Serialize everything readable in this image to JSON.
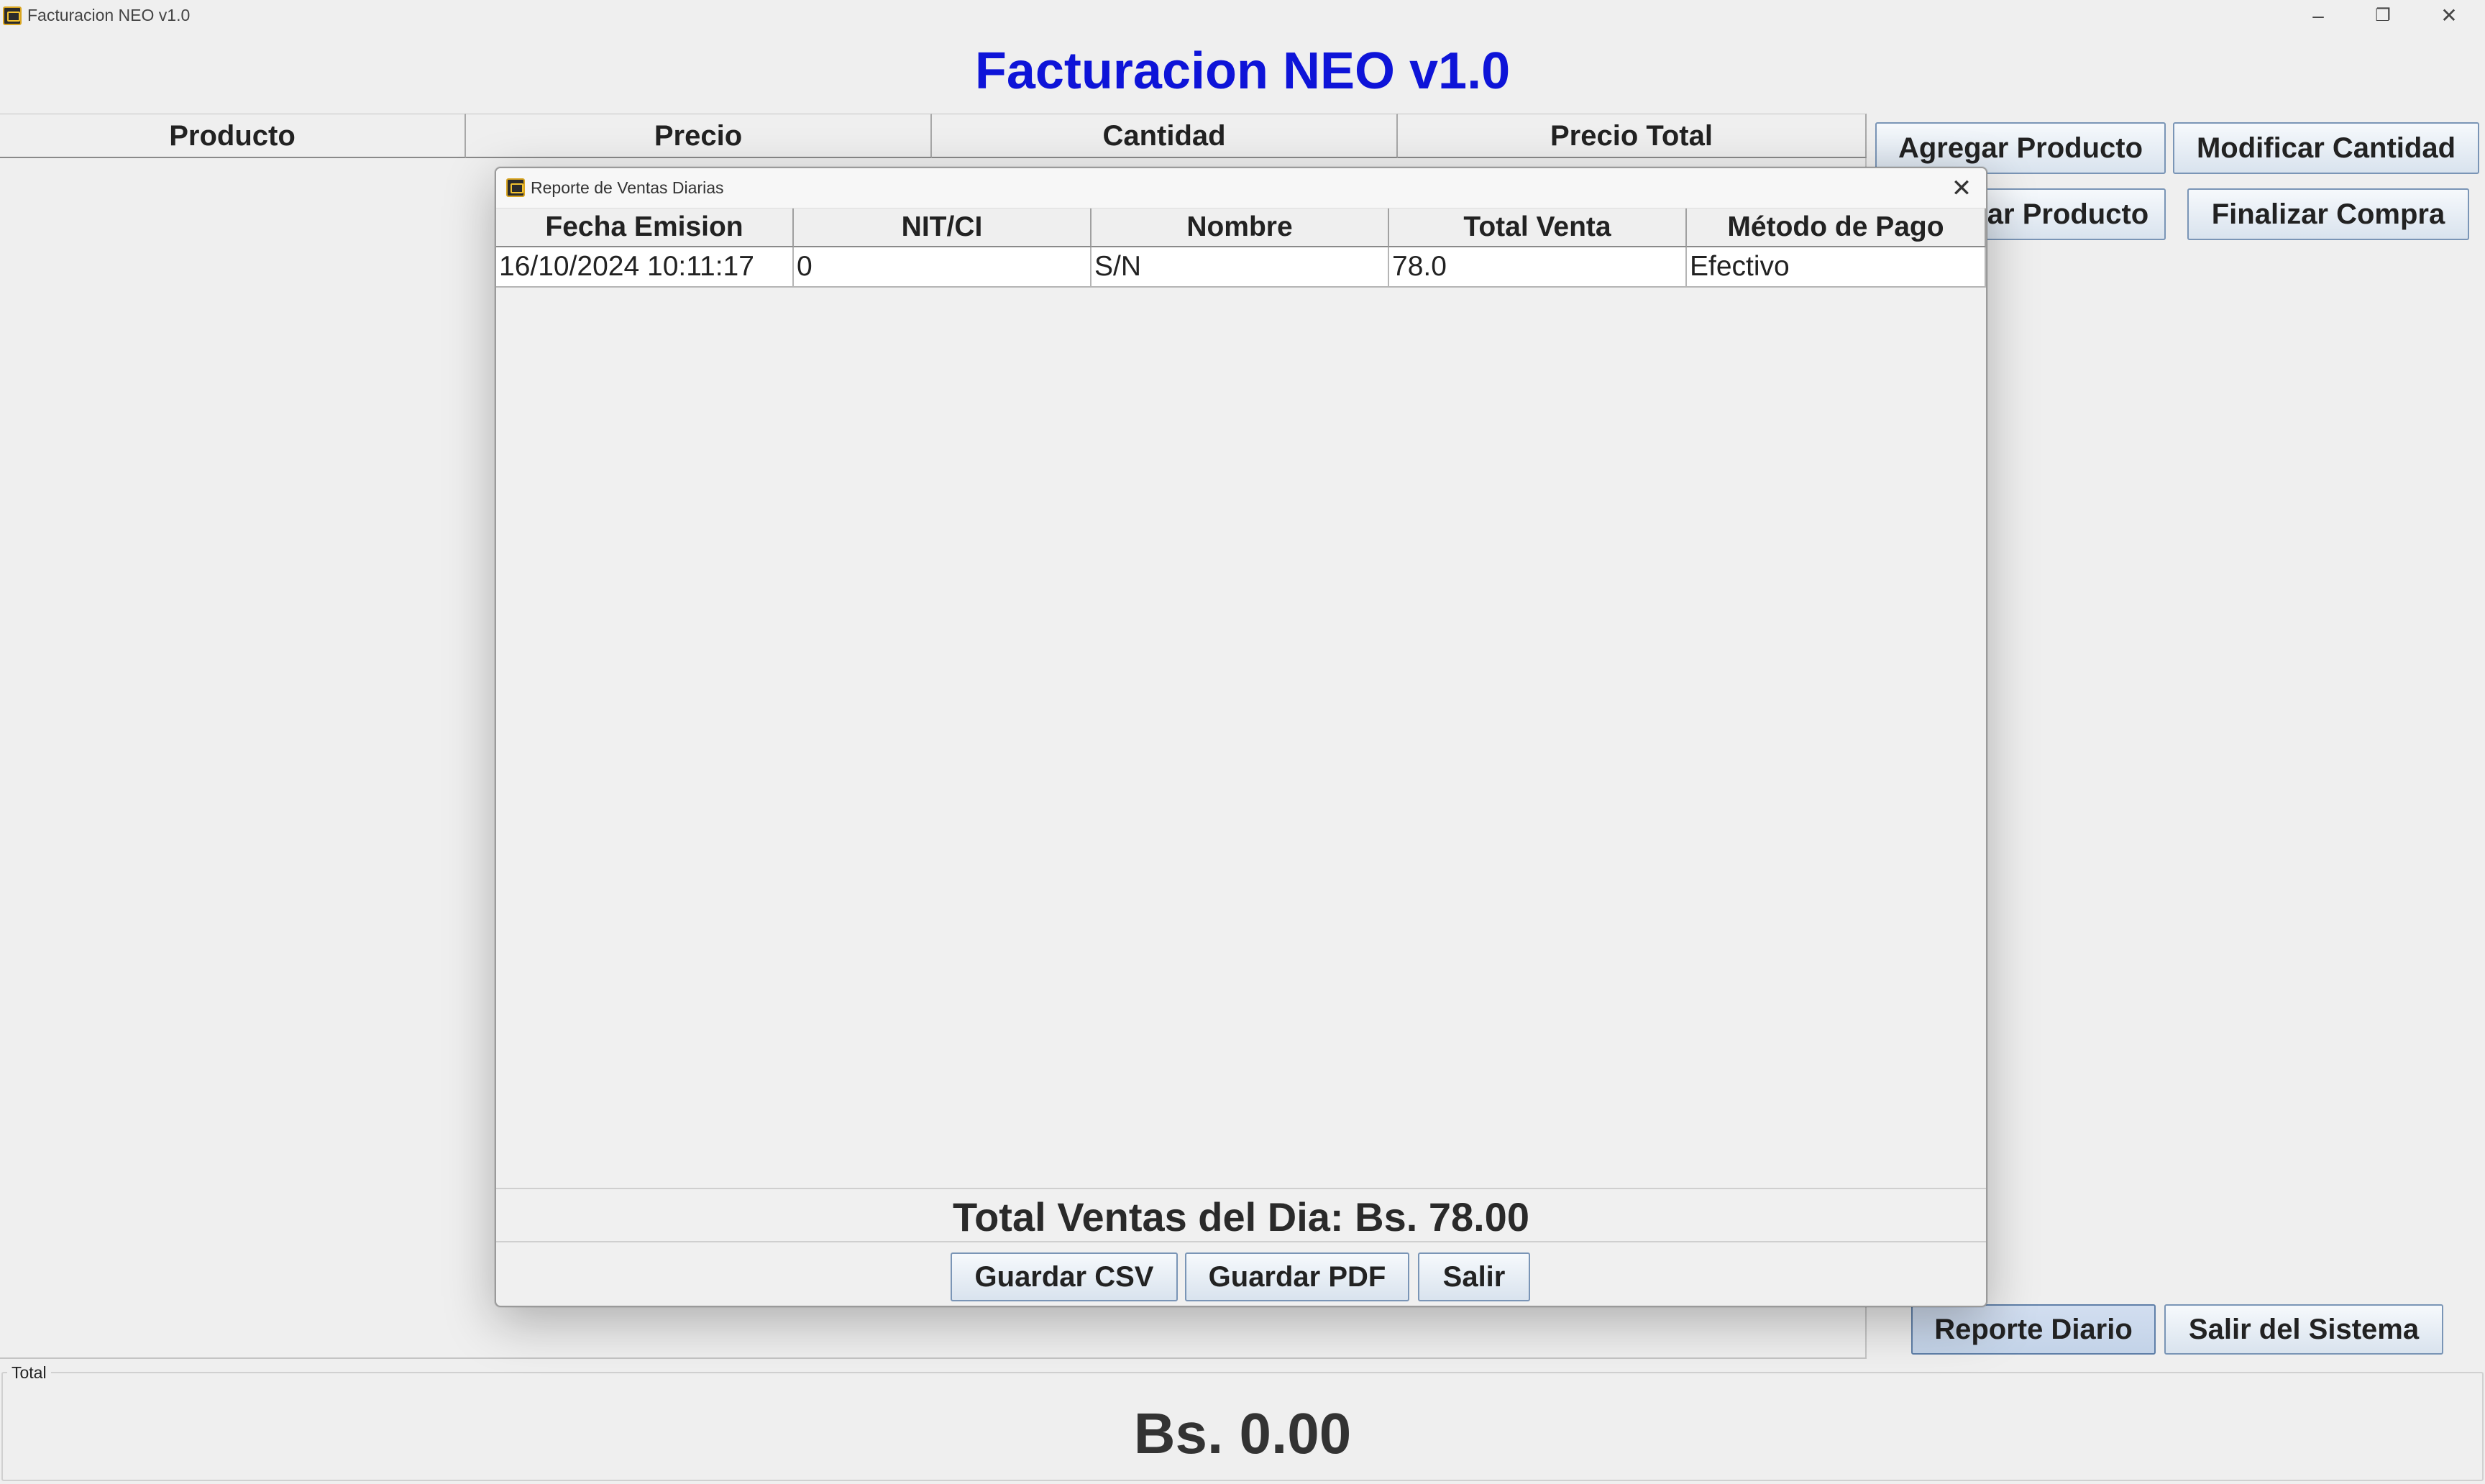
{
  "window": {
    "title": "Facturacion NEO v1.0",
    "minimize_glyph": "–",
    "restore_glyph": "❐",
    "close_glyph": "✕"
  },
  "heading": "Facturacion NEO v1.0",
  "main_table": {
    "columns": [
      "Producto",
      "Precio",
      "Cantidad",
      "Precio Total"
    ]
  },
  "buttons": {
    "agregar": "Agregar Producto",
    "modificar": "Modificar Cantidad",
    "eliminar": "Eliminar Producto",
    "finalizar": "Finalizar Compra",
    "reporte": "Reporte Diario",
    "salir_sistema": "Salir del Sistema"
  },
  "total": {
    "legend": "Total",
    "value": "Bs. 0.00"
  },
  "dialog": {
    "title": "Reporte de Ventas Diarias",
    "close_glyph": "✕",
    "columns": [
      "Fecha Emision",
      "NIT/CI",
      "Nombre",
      "Total Venta",
      "Método de Pago"
    ],
    "rows": [
      [
        "16/10/2024 10:11:17",
        "0",
        "S/N",
        "78.0",
        "Efectivo"
      ]
    ],
    "total_text": "Total Ventas del Dia: Bs. 78.00",
    "buttons": {
      "csv": "Guardar CSV",
      "pdf": "Guardar PDF",
      "salir": "Salir"
    }
  },
  "icons": {
    "app": "app-icon",
    "dialog": "app-icon",
    "minimize": "minimize-icon",
    "restore": "restore-icon",
    "close": "close-icon"
  },
  "colors": {
    "heading": "#0e14d8",
    "button_border": "#7a95b6"
  }
}
